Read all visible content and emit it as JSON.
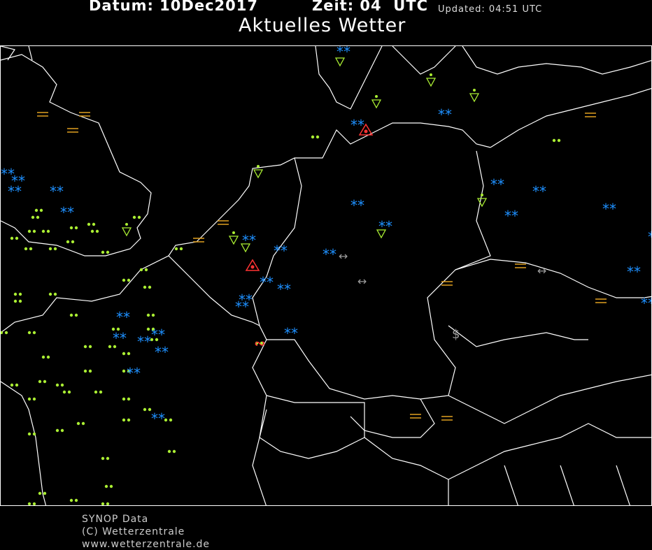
{
  "header": {
    "date_text": "Datum: 10Dec2017",
    "time_text": "Zeit: 04  UTC",
    "updated_text": "Updated: 04:51 UTC",
    "title": "Aktuelles Wetter"
  },
  "footer": {
    "line1": "SYNOP Data",
    "line2": "(C) Wetterzentrale",
    "line3": "www.wetterzentrale.de"
  },
  "colors": {
    "background": "#000000",
    "coast": "#ffffff",
    "drizzle": "#aaee33",
    "snow": "#1e90ff",
    "fog": "#e0a020",
    "thunder": "#ff3333",
    "other": "#9a9a9a"
  },
  "legend_symbols": {
    "rain": "rain-dots-icon",
    "snow": "snow-asterisk-icon",
    "shower": "shower-triangle-icon",
    "fog": "fog-bars-icon",
    "thunder": "thunderstorm-triangle-icon",
    "dust": "dust-haze-icon",
    "arrow": "horizontal-arrow-icon",
    "drifting": "dollar-sign-icon"
  }
}
